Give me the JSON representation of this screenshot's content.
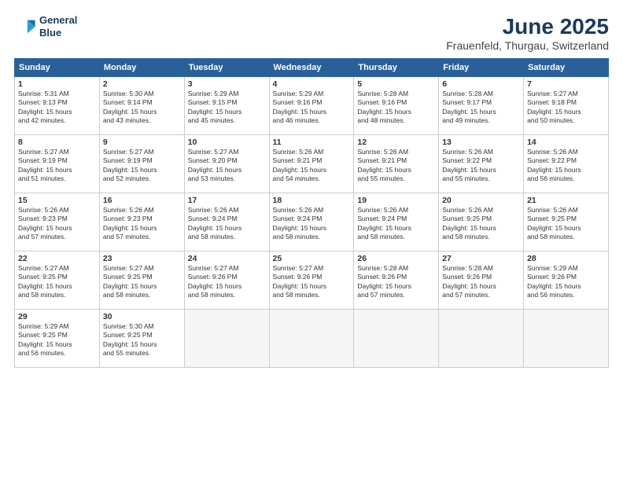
{
  "logo": {
    "line1": "General",
    "line2": "Blue"
  },
  "title": "June 2025",
  "subtitle": "Frauenfeld, Thurgau, Switzerland",
  "weekdays": [
    "Sunday",
    "Monday",
    "Tuesday",
    "Wednesday",
    "Thursday",
    "Friday",
    "Saturday"
  ],
  "weeks": [
    [
      {
        "day": "1",
        "sunrise": "5:31 AM",
        "sunset": "9:13 PM",
        "daylight": "15 hours and 42 minutes."
      },
      {
        "day": "2",
        "sunrise": "5:30 AM",
        "sunset": "9:14 PM",
        "daylight": "15 hours and 43 minutes."
      },
      {
        "day": "3",
        "sunrise": "5:29 AM",
        "sunset": "9:15 PM",
        "daylight": "15 hours and 45 minutes."
      },
      {
        "day": "4",
        "sunrise": "5:29 AM",
        "sunset": "9:16 PM",
        "daylight": "15 hours and 46 minutes."
      },
      {
        "day": "5",
        "sunrise": "5:28 AM",
        "sunset": "9:16 PM",
        "daylight": "15 hours and 48 minutes."
      },
      {
        "day": "6",
        "sunrise": "5:28 AM",
        "sunset": "9:17 PM",
        "daylight": "15 hours and 49 minutes."
      },
      {
        "day": "7",
        "sunrise": "5:27 AM",
        "sunset": "9:18 PM",
        "daylight": "15 hours and 50 minutes."
      }
    ],
    [
      {
        "day": "8",
        "sunrise": "5:27 AM",
        "sunset": "9:19 PM",
        "daylight": "15 hours and 51 minutes."
      },
      {
        "day": "9",
        "sunrise": "5:27 AM",
        "sunset": "9:19 PM",
        "daylight": "15 hours and 52 minutes."
      },
      {
        "day": "10",
        "sunrise": "5:27 AM",
        "sunset": "9:20 PM",
        "daylight": "15 hours and 53 minutes."
      },
      {
        "day": "11",
        "sunrise": "5:26 AM",
        "sunset": "9:21 PM",
        "daylight": "15 hours and 54 minutes."
      },
      {
        "day": "12",
        "sunrise": "5:26 AM",
        "sunset": "9:21 PM",
        "daylight": "15 hours and 55 minutes."
      },
      {
        "day": "13",
        "sunrise": "5:26 AM",
        "sunset": "9:22 PM",
        "daylight": "15 hours and 55 minutes."
      },
      {
        "day": "14",
        "sunrise": "5:26 AM",
        "sunset": "9:22 PM",
        "daylight": "15 hours and 56 minutes."
      }
    ],
    [
      {
        "day": "15",
        "sunrise": "5:26 AM",
        "sunset": "9:23 PM",
        "daylight": "15 hours and 57 minutes."
      },
      {
        "day": "16",
        "sunrise": "5:26 AM",
        "sunset": "9:23 PM",
        "daylight": "15 hours and 57 minutes."
      },
      {
        "day": "17",
        "sunrise": "5:26 AM",
        "sunset": "9:24 PM",
        "daylight": "15 hours and 58 minutes."
      },
      {
        "day": "18",
        "sunrise": "5:26 AM",
        "sunset": "9:24 PM",
        "daylight": "15 hours and 58 minutes."
      },
      {
        "day": "19",
        "sunrise": "5:26 AM",
        "sunset": "9:24 PM",
        "daylight": "15 hours and 58 minutes."
      },
      {
        "day": "20",
        "sunrise": "5:26 AM",
        "sunset": "9:25 PM",
        "daylight": "15 hours and 58 minutes."
      },
      {
        "day": "21",
        "sunrise": "5:26 AM",
        "sunset": "9:25 PM",
        "daylight": "15 hours and 58 minutes."
      }
    ],
    [
      {
        "day": "22",
        "sunrise": "5:27 AM",
        "sunset": "9:25 PM",
        "daylight": "15 hours and 58 minutes."
      },
      {
        "day": "23",
        "sunrise": "5:27 AM",
        "sunset": "9:25 PM",
        "daylight": "15 hours and 58 minutes."
      },
      {
        "day": "24",
        "sunrise": "5:27 AM",
        "sunset": "9:26 PM",
        "daylight": "15 hours and 58 minutes."
      },
      {
        "day": "25",
        "sunrise": "5:27 AM",
        "sunset": "9:26 PM",
        "daylight": "15 hours and 58 minutes."
      },
      {
        "day": "26",
        "sunrise": "5:28 AM",
        "sunset": "9:26 PM",
        "daylight": "15 hours and 57 minutes."
      },
      {
        "day": "27",
        "sunrise": "5:28 AM",
        "sunset": "9:26 PM",
        "daylight": "15 hours and 57 minutes."
      },
      {
        "day": "28",
        "sunrise": "5:29 AM",
        "sunset": "9:26 PM",
        "daylight": "15 hours and 56 minutes."
      }
    ],
    [
      {
        "day": "29",
        "sunrise": "5:29 AM",
        "sunset": "9:25 PM",
        "daylight": "15 hours and 56 minutes."
      },
      {
        "day": "30",
        "sunrise": "5:30 AM",
        "sunset": "9:25 PM",
        "daylight": "15 hours and 55 minutes."
      },
      null,
      null,
      null,
      null,
      null
    ]
  ],
  "colors": {
    "header_bg": "#2a6099",
    "header_text": "#ffffff",
    "title_color": "#1a3a5c"
  }
}
